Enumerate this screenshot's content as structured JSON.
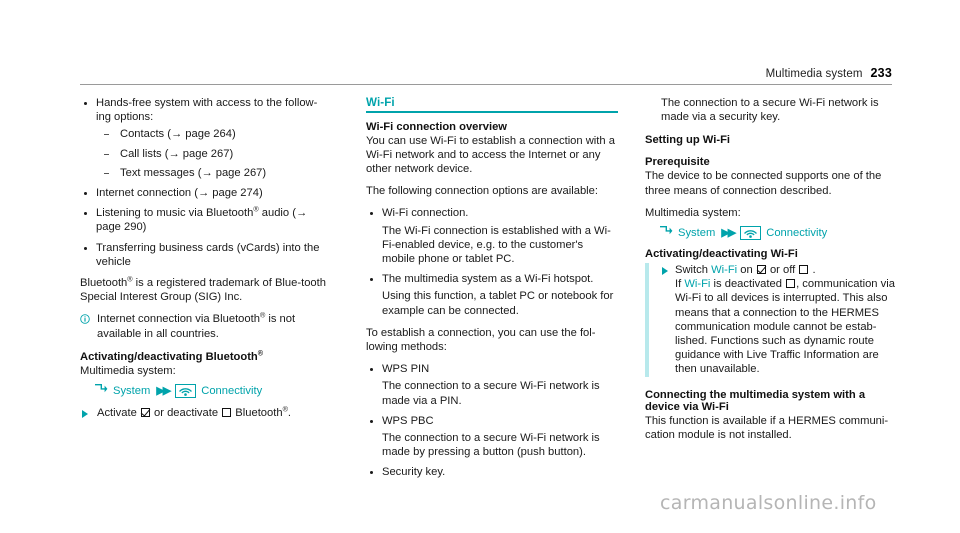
{
  "header": {
    "title": "Multimedia system",
    "page_number": "233"
  },
  "left_column": {
    "bullets": [
      {
        "text": "Hands-free system with access to the follow-ing options:",
        "sub_items": [
          "Contacts (→ page 264)",
          "Call lists (→ page 267)",
          "Text messages (→ page 267)"
        ]
      },
      {
        "text": "Internet connection (→ page 274)"
      },
      {
        "text": "Listening to music via Bluetooth® audio (→ page 290)"
      },
      {
        "text": "Transferring business cards (vCards) into the vehicle"
      }
    ],
    "trademark_paragraph": "Bluetooth® is a registered trademark of Blue-tooth Special Interest Group (SIG) Inc.",
    "note": "Internet connection via Bluetooth® is not available in all countries.",
    "heading": "Activating/deactivating Bluetooth®",
    "system_label": "Multimedia system:",
    "nav_path": {
      "first": "System",
      "second": "Connectivity"
    },
    "action": {
      "prefix": "Activate",
      "middle": "or deactivate",
      "suffix": "Bluetooth®."
    }
  },
  "middle_column": {
    "section_heading": "Wi-Fi",
    "overview_heading": "Wi-Fi connection overview",
    "overview_paragraph": "You can use Wi-Fi to establish a connection with a Wi-Fi network and to access the Internet or any other network device.",
    "options_intro": "The following connection options are available:",
    "options": [
      {
        "title": "Wi-Fi connection.",
        "detail": "The Wi-Fi connection is established with a Wi-Fi-enabled device, e.g. to the customer's mobile phone or tablet PC."
      },
      {
        "title": "The multimedia system as a Wi-Fi hotspot.",
        "detail": "Using this function, a tablet PC or notebook for example can be connected."
      }
    ],
    "methods_intro": "To establish a connection, you can use the fol-lowing methods:",
    "methods": [
      {
        "title": "WPS PIN",
        "detail": "The connection to a secure Wi-Fi network is made via a PIN."
      },
      {
        "title": "WPS PBC",
        "detail": "The connection to a secure Wi-Fi network is made by pressing a button (push button)."
      },
      {
        "title": "Security key.",
        "detail": ""
      }
    ]
  },
  "right_column": {
    "security_key_detail": "The connection to a secure Wi-Fi network is made via a security key.",
    "setup_heading": "Setting up Wi-Fi",
    "prerequisite_heading": "Prerequisite",
    "prerequisite_paragraph": "The device to be connected supports one of the three means of connection described.",
    "system_label": "Multimedia system:",
    "nav_path": {
      "first": "System",
      "second": "Connectivity"
    },
    "activate_heading": "Activating/deactivating Wi-Fi",
    "action": {
      "prefix": "Switch",
      "link": "Wi-Fi",
      "mid1": "on",
      "mid2": "or off",
      "suffix": "."
    },
    "warning_body": {
      "lead_if": "If",
      "lead_link": "Wi-Fi",
      "lead_rest": "is deactivated",
      "rest": ", communication via Wi-Fi to all devices is interrupted. This also means that a connection to the HERMES communication module cannot be estab-lished. Functions such as dynamic route guidance with Live Traffic Information are then unavailable."
    },
    "connecting_heading": "Connecting the multimedia system with a device via Wi-Fi",
    "connecting_paragraph": "This function is available if a HERMES communi-cation module is not installed."
  },
  "watermark": "carmanualsonline.info",
  "colors": {
    "teal": "#00a3ab",
    "highlight_bar": "#b8e9ec",
    "rule": "#9a9a9a"
  }
}
